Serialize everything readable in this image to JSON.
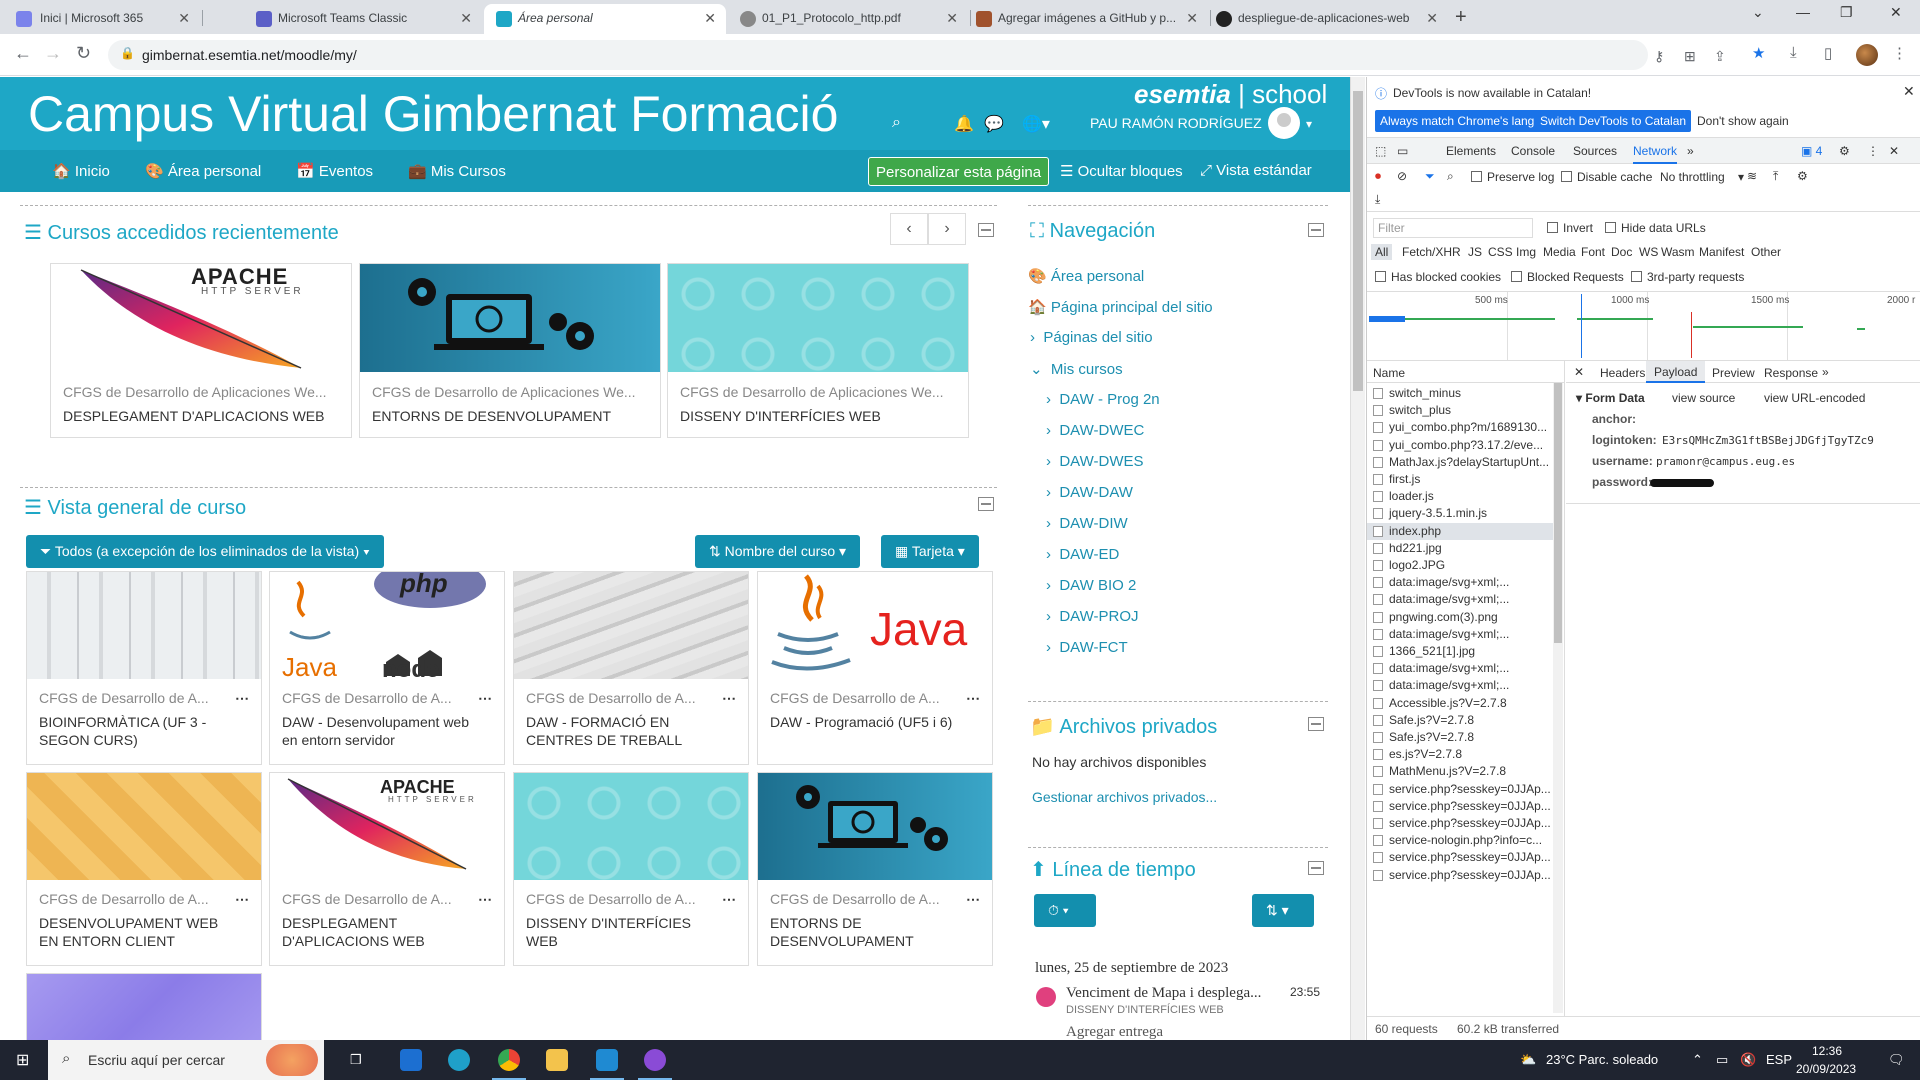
{
  "browser": {
    "tabs": [
      {
        "title": "Inici | Microsoft 365",
        "color": "#7b83eb"
      },
      {
        "title": "Microsoft Teams Classic",
        "color": "#5b5fc7"
      },
      {
        "title": "Área personal",
        "color": "#1ea7c6"
      },
      {
        "title": "01_P1_Protocolo_http.pdf",
        "color": "#555"
      },
      {
        "title": "Agregar imágenes a GitHub y p...",
        "color": "#a0522d"
      },
      {
        "title": "despliegue-de-aplicaciones-web",
        "color": "#222"
      }
    ],
    "url": "gimbernat.esemtia.net/moodle/my/"
  },
  "moodle": {
    "site_title": "Campus Virtual Gimbernat Formació",
    "brand": "esemtia",
    "brand_suffix": "school",
    "username": "PAU RAMÓN RODRÍGUEZ",
    "nav": {
      "inicio": "Inicio",
      "area": "Área personal",
      "eventos": "Eventos",
      "cursos": "Mis Cursos",
      "customize": "Personalizar esta página",
      "hide_blocks": "Ocultar bloques",
      "standard": "Vista estándar"
    },
    "recent": {
      "title": "Cursos accedidos recientemente",
      "courses": [
        {
          "category": "CFGS de Desarrollo de Aplicaciones We...",
          "name": "DESPLEGAMENT D'APLICACIONS WEB"
        },
        {
          "category": "CFGS de Desarrollo de Aplicaciones We...",
          "name": "ENTORNS DE DESENVOLUPAMENT"
        },
        {
          "category": "CFGS de Desarrollo de Aplicaciones We...",
          "name": "DISSENY D'INTERFÍCIES WEB"
        }
      ]
    },
    "overview": {
      "title": "Vista general de curso",
      "filter": "Todos (a excepción de los eliminados de la vista)",
      "sort": "Nombre del curso",
      "view": "Tarjeta",
      "courses": [
        {
          "category": "CFGS de Desarrollo de A...",
          "name": "BIOINFORMÀTICA (UF 3 - SEGON CURS)"
        },
        {
          "category": "CFGS de Desarrollo de A...",
          "name": "DAW - Desenvolupament web en entorn servidor"
        },
        {
          "category": "CFGS de Desarrollo de A...",
          "name": "DAW - FORMACIÓ EN CENTRES DE TREBALL"
        },
        {
          "category": "CFGS de Desarrollo de A...",
          "name": "DAW - Programació (UF5 i 6)"
        },
        {
          "category": "CFGS de Desarrollo de A...",
          "name": "DESENVOLUPAMENT WEB EN ENTORN CLIENT"
        },
        {
          "category": "CFGS de Desarrollo de A...",
          "name": "DESPLEGAMENT D'APLICACIONS WEB"
        },
        {
          "category": "CFGS de Desarrollo de A...",
          "name": "DISSENY D'INTERFÍCIES WEB"
        },
        {
          "category": "CFGS de Desarrollo de A...",
          "name": "ENTORNS DE DESENVOLUPAMENT"
        }
      ]
    },
    "navigation": {
      "title": "Navegación",
      "area": "Área personal",
      "home": "Página principal del sitio",
      "pages": "Páginas del sitio",
      "my_courses": "Mis cursos",
      "courses": [
        "DAW - Prog 2n",
        "DAW-DWEC",
        "DAW-DWES",
        "DAW-DAW",
        "DAW-DIW",
        "DAW-ED",
        "DAW BIO 2",
        "DAW-PROJ",
        "DAW-FCT"
      ]
    },
    "private_files": {
      "title": "Archivos privados",
      "empty": "No hay archivos disponibles",
      "manage": "Gestionar archivos privados..."
    },
    "timeline": {
      "title": "Línea de tiempo",
      "date": "lunes, 25 de septiembre de 2023",
      "event_title": "Venciment de Mapa i desplega...",
      "event_time": "23:55",
      "event_course": "DISSENY D'INTERFÍCIES WEB",
      "event_action": "Agregar entrega"
    },
    "logos": {
      "apache": "APACHE",
      "apache_sub": "HTTP SERVER",
      "java": "Java",
      "java_small": "Java",
      "php": "php",
      "node": "node"
    }
  },
  "devtools": {
    "info": "DevTools is now available in Catalan!",
    "btn_match": "Always match Chrome's language",
    "btn_switch": "Switch DevTools to Catalan",
    "btn_dont": "Don't show again",
    "tabs": [
      "Elements",
      "Console",
      "Sources",
      "Network"
    ],
    "badge": "4",
    "preserve_log": "Preserve log",
    "disable_cache": "Disable cache",
    "throttling": "No throttling",
    "filter_placeholder": "Filter",
    "invert": "Invert",
    "hide_data_urls": "Hide data URLs",
    "type_filters": [
      "All",
      "Fetch/XHR",
      "JS",
      "CSS",
      "Img",
      "Media",
      "Font",
      "Doc",
      "WS",
      "Wasm",
      "Manifest",
      "Other"
    ],
    "has_blocked_cookies": "Has blocked cookies",
    "blocked_requests": "Blocked Requests",
    "third_party": "3rd-party requests",
    "timeline_labels": [
      "500 ms",
      "1000 ms",
      "1500 ms",
      "2000 r"
    ],
    "name_header": "Name",
    "requests": [
      "switch_minus",
      "switch_plus",
      "yui_combo.php?m/1689130...",
      "yui_combo.php?3.17.2/eve...",
      "MathJax.js?delayStartupUnt...",
      "first.js",
      "loader.js",
      "jquery-3.5.1.min.js",
      "index.php",
      "hd221.jpg",
      "logo2.JPG",
      "data:image/svg+xml;...",
      "data:image/svg+xml;...",
      "pngwing.com(3).png",
      "data:image/svg+xml;...",
      "1366_521[1].jpg",
      "data:image/svg+xml;...",
      "data:image/svg+xml;...",
      "Accessible.js?V=2.7.8",
      "Safe.js?V=2.7.8",
      "Safe.js?V=2.7.8",
      "es.js?V=2.7.8",
      "MathMenu.js?V=2.7.8",
      "service.php?sesskey=0JJAp...",
      "service.php?sesskey=0JJAp...",
      "service.php?sesskey=0JJAp...",
      "service-nologin.php?info=c...",
      "service.php?sesskey=0JJAp...",
      "service.php?sesskey=0JJAp..."
    ],
    "detail_tabs": [
      "Headers",
      "Payload",
      "Preview",
      "Response"
    ],
    "form_data": "Form Data",
    "view_source": "view source",
    "view_url": "view URL-encoded",
    "anchor_label": "anchor:",
    "token_label": "logintoken:",
    "token_value": "E3rsQMHcZm3G1ftBSBejJDGfjTgyTZc9",
    "username_label": "username:",
    "username_value": "pramonr@campus.eug.es",
    "password_label": "password:",
    "footer_requests": "60 requests",
    "footer_transferred": "60.2 kB transferred"
  },
  "taskbar": {
    "search": "Escriu aquí per cercar",
    "weather": "23°C  Parc. soleado",
    "lang": "ESP",
    "time": "12:36",
    "date": "20/09/2023"
  }
}
